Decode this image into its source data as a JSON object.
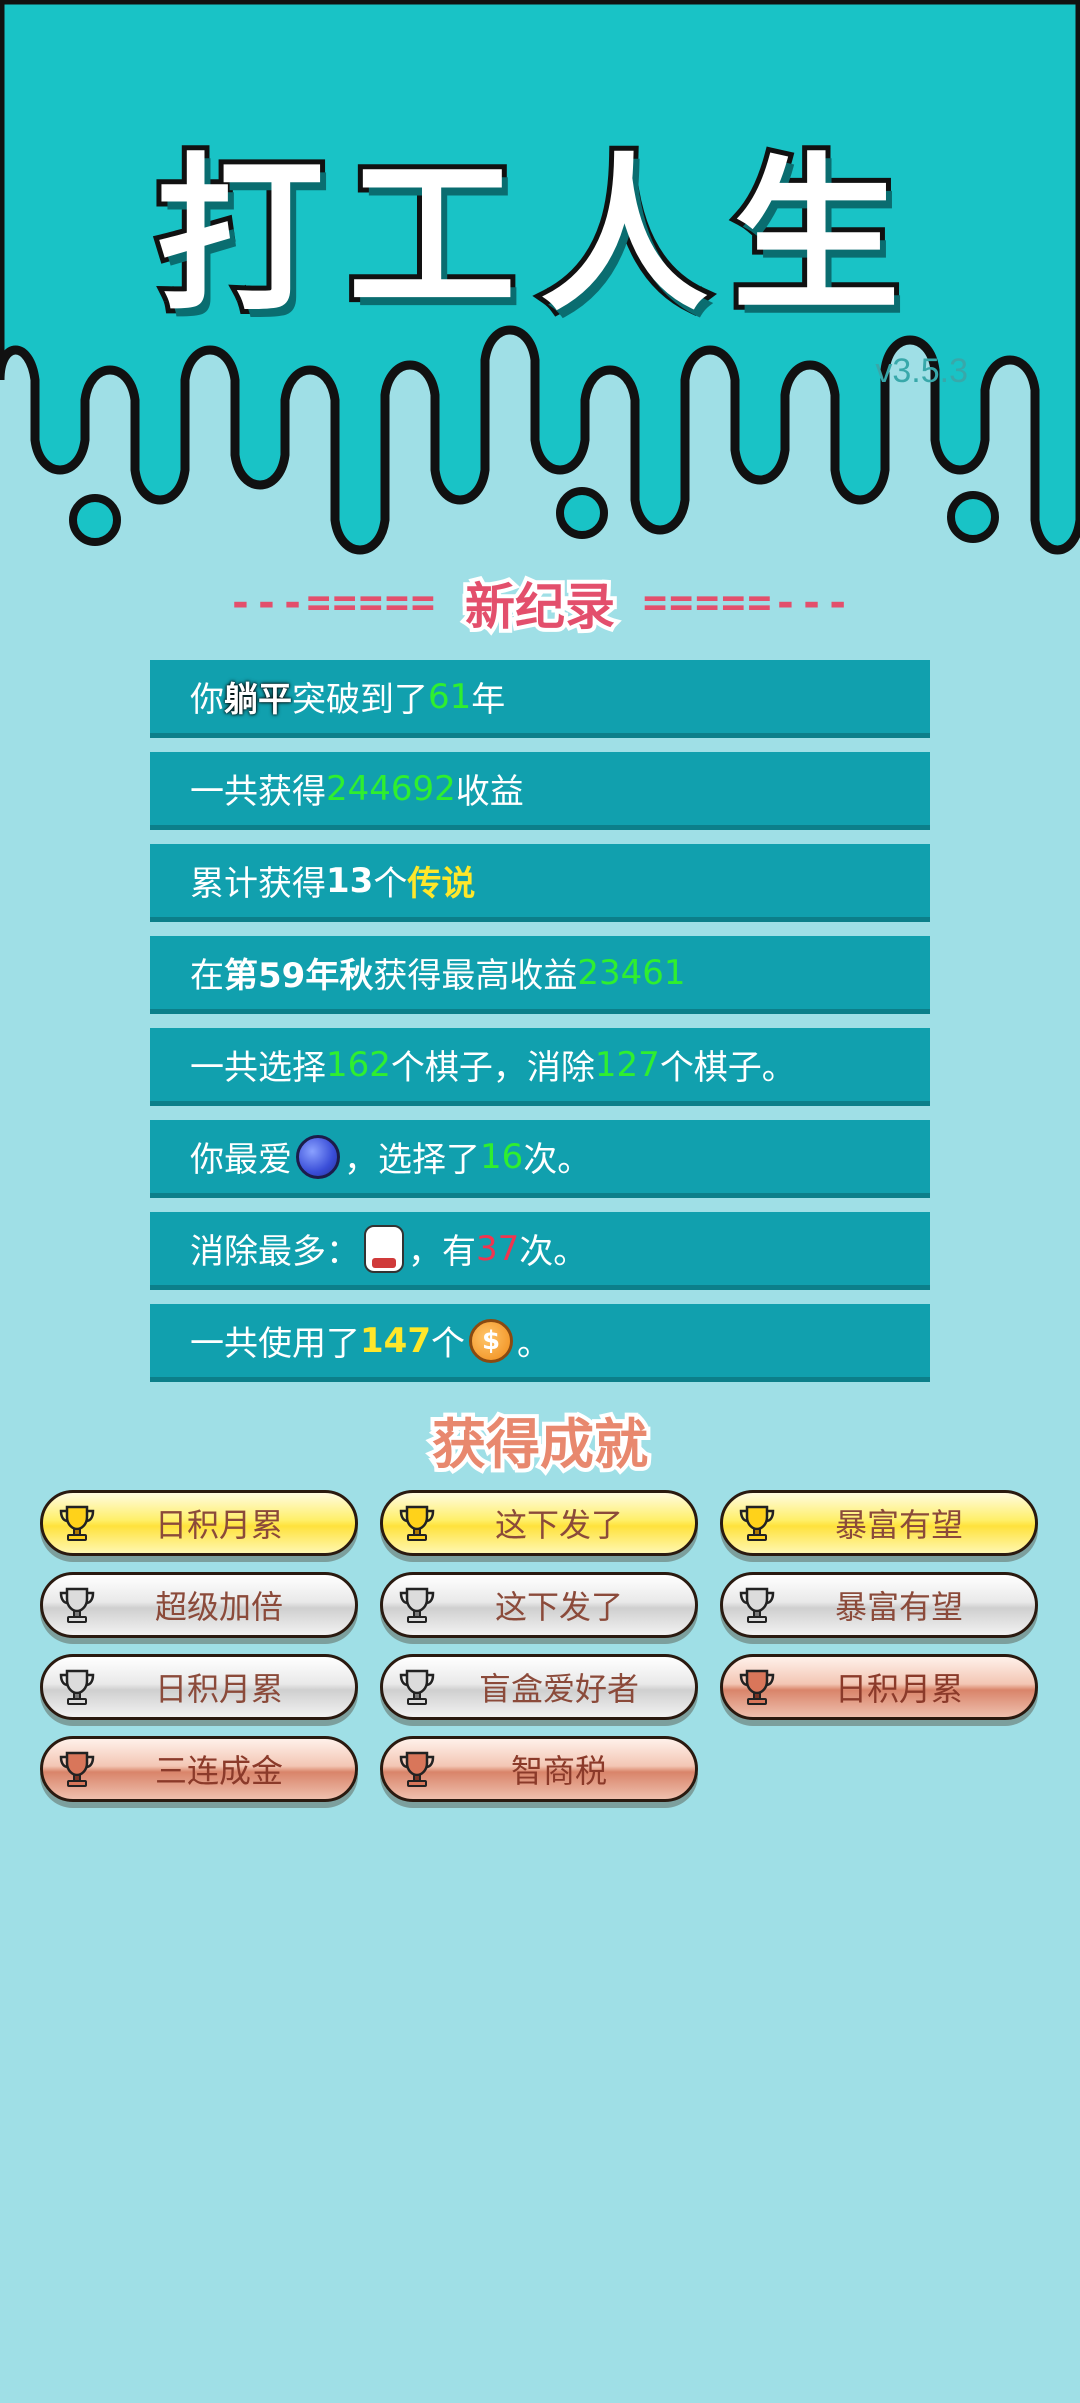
{
  "header": {
    "title": "打工人生",
    "version": "v3.5.3"
  },
  "record": {
    "dashes_left": "---=====",
    "title": "新纪录",
    "dashes_right": "=====---"
  },
  "stats": [
    {
      "parts": [
        "你",
        "躺平",
        "突破到了",
        "61",
        "年"
      ]
    },
    {
      "parts": [
        "一共获得",
        "244692",
        "收益"
      ]
    },
    {
      "parts": [
        "累计获得",
        "13",
        "个",
        "传说"
      ]
    },
    {
      "parts": [
        "在 ",
        "第59年秋",
        " 获得最高收益",
        "23461"
      ]
    },
    {
      "parts": [
        "一共选择",
        "162",
        "个棋子，消除",
        "127",
        "个棋子。"
      ]
    },
    {
      "parts": [
        "你最爱",
        "blueberry-icon",
        "，选择了",
        "16",
        "次。"
      ]
    },
    {
      "parts": [
        "消除最多：",
        "bunny-icon",
        "，有",
        "37",
        "次。"
      ]
    },
    {
      "parts": [
        "一共使用了",
        "147",
        "个",
        "coin-icon",
        "。"
      ]
    }
  ],
  "achievements_title": "获得成就",
  "achievements": [
    {
      "name": "日积月累",
      "tier": "gold"
    },
    {
      "name": "这下发了",
      "tier": "gold"
    },
    {
      "name": "暴富有望",
      "tier": "gold"
    },
    {
      "name": "超级加倍",
      "tier": "silver"
    },
    {
      "name": "这下发了",
      "tier": "silver"
    },
    {
      "name": "暴富有望",
      "tier": "silver"
    },
    {
      "name": "日积月累",
      "tier": "silver"
    },
    {
      "name": "盲盒爱好者",
      "tier": "silver"
    },
    {
      "name": "日积月累",
      "tier": "bronze"
    },
    {
      "name": "三连成金",
      "tier": "bronze"
    },
    {
      "name": "智商税",
      "tier": "bronze"
    }
  ],
  "colors": {
    "header_bg": "#19c3c6",
    "page_bg": "#9fdfe6",
    "row_bg": "#11a0ae",
    "green": "#2fef2f",
    "yellow": "#ffe72a",
    "red": "#f0354f",
    "accent_pink": "#e34f6c"
  }
}
